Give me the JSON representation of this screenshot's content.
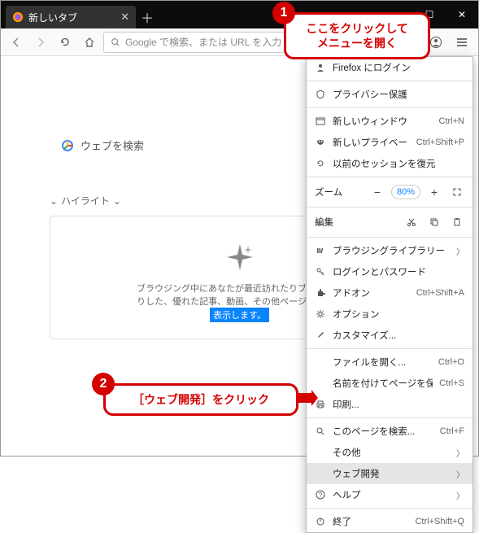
{
  "tab": {
    "title": "新しいタブ"
  },
  "toolbar": {
    "placeholder": "Google で検索、または URL を入力しま"
  },
  "content": {
    "search_placeholder": "ウェブを検索",
    "highlights_label": "ハイライト",
    "card_text1": "ブラウジング中にあなたが最近訪れたりブックマー",
    "card_text2": "りした、優れた記事、動画、その他ページの一部を",
    "card_link": "表示します。"
  },
  "menu": {
    "signin": "Firefox にログイン",
    "privacy": "プライバシー保護",
    "new_window": {
      "label": "新しいウィンドウ",
      "shortcut": "Ctrl+N"
    },
    "new_private": {
      "label": "新しいプライベートウィンドウ",
      "shortcut": "Ctrl+Shift+P"
    },
    "restore": "以前のセッションを復元",
    "zoom_label": "ズーム",
    "zoom_pct": "80%",
    "edit_label": "編集",
    "library": "ブラウジングライブラリー",
    "logins": "ログインとパスワード",
    "addons": {
      "label": "アドオン",
      "shortcut": "Ctrl+Shift+A"
    },
    "options": "オプション",
    "customize": "カスタマイズ...",
    "open_file": {
      "label": "ファイルを開く...",
      "shortcut": "Ctrl+O"
    },
    "save_as": {
      "label": "名前を付けてページを保存...",
      "shortcut": "Ctrl+S"
    },
    "print": "印刷...",
    "find": {
      "label": "このページを検索...",
      "shortcut": "Ctrl+F"
    },
    "more": "その他",
    "webdev": "ウェブ開発",
    "help": "ヘルプ",
    "exit": {
      "label": "終了",
      "shortcut": "Ctrl+Shift+Q"
    }
  },
  "callouts": {
    "c1": "ここをクリックして\nメニューを開く",
    "c2": "［ウェブ開発］をクリック",
    "n1": "1",
    "n2": "2"
  }
}
